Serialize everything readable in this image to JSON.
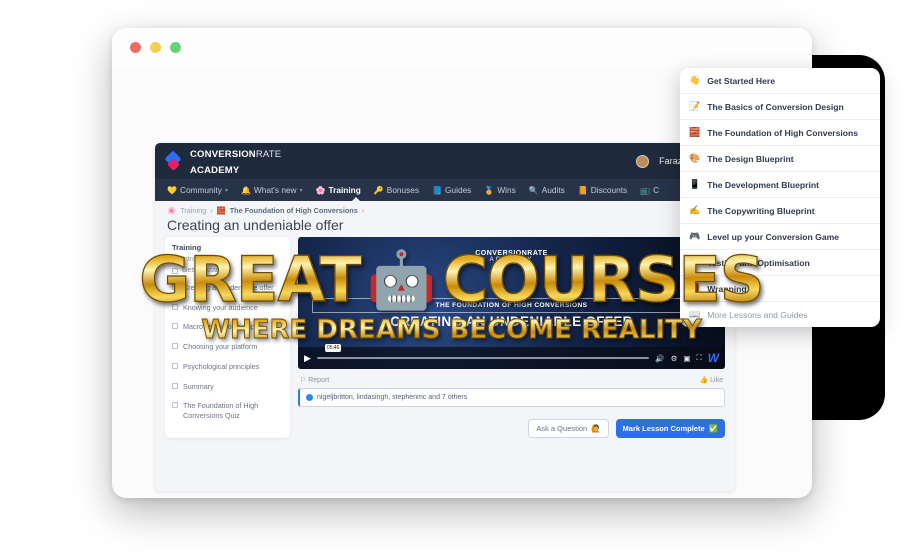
{
  "browser": {
    "traffic_lights": [
      "close",
      "minimize",
      "maximize"
    ]
  },
  "app": {
    "logo": {
      "line1_bold": "CONVERSION",
      "line1_thin": "RATE",
      "line2": "ACADEMY"
    },
    "user": {
      "name": "Faraz",
      "mail_icon": "mail-icon",
      "bell_icon": "bell-icon"
    },
    "nav": [
      {
        "label": "Community",
        "emoji": "💛",
        "caret": "▾",
        "active": false
      },
      {
        "label": "What's new",
        "emoji": "🔔",
        "caret": "▾",
        "active": false
      },
      {
        "label": "Training",
        "emoji": "🌸",
        "caret": "",
        "active": true
      },
      {
        "label": "Bonuses",
        "emoji": "🔑",
        "caret": "",
        "active": false
      },
      {
        "label": "Guides",
        "emoji": "📘",
        "caret": "",
        "active": false
      },
      {
        "label": "Wins",
        "emoji": "🏅",
        "caret": "",
        "active": false
      },
      {
        "label": "Audits",
        "emoji": "🔍",
        "caret": "",
        "active": false
      },
      {
        "label": "Discounts",
        "emoji": "📙",
        "caret": "",
        "active": false
      },
      {
        "label": "C",
        "emoji": "📺",
        "caret": "",
        "active": false
      }
    ],
    "breadcrumb": {
      "parent": "Training",
      "parent_emoji": "🌸",
      "current": "The Foundation of High Conversions",
      "current_emoji": "🧱",
      "separator": "›"
    },
    "page_title": "Creating an undeniable offer",
    "lesson_panel": {
      "heading": "Training",
      "sub1": "Introduction",
      "sub2": "Getting started",
      "items": [
        "Creating an undeniable offer",
        "Knowing your audience",
        "Macro vs micro principles",
        "Choosing your platform",
        "Psychological principles",
        "Summary",
        "The Foundation of High Conversions Quiz"
      ]
    },
    "video": {
      "brand_line1": "CONVERSIONRATE",
      "brand_line2": "ACADEMY",
      "band_title": "THE FOUNDATION OF HIGH CONVERSIONS",
      "title": "CREATING AN UNDENIABLE OFFER",
      "play_icon": "play-icon",
      "timestamp": "05:46",
      "volume_icon": "volume-icon",
      "settings_icon": "gear-icon",
      "pip_icon": "picture-in-picture-icon",
      "fullscreen_icon": "fullscreen-icon",
      "watermark": "W"
    },
    "actions": {
      "report_label": "Report",
      "report_icon": "flag-icon",
      "like_label": "Like",
      "like_icon": "thumbs-up-icon",
      "likes_text": "nigeljbritton, lindasingh, stephenmc and 7 others",
      "ask_question_label": "Ask a Question",
      "ask_question_emoji": "🙋",
      "mark_complete_label": "Mark Lesson Complete",
      "mark_complete_emoji": "✅"
    }
  },
  "dropdown": {
    "items": [
      {
        "emoji": "👋",
        "label": "Get Started Here",
        "muted": false
      },
      {
        "emoji": "📝",
        "label": "The Basics of Conversion Design",
        "muted": false
      },
      {
        "emoji": "🧱",
        "label": "The Foundation of High Conversions",
        "muted": false
      },
      {
        "emoji": "🎨",
        "label": "The Design Blueprint",
        "muted": false
      },
      {
        "emoji": "📱",
        "label": "The Development Blueprint",
        "muted": false
      },
      {
        "emoji": "✍️",
        "label": "The Copywriting Blueprint",
        "muted": false
      },
      {
        "emoji": "🎮",
        "label": "Level up your Conversion Game",
        "muted": false
      },
      {
        "emoji": "🧪",
        "label": "Testing and Optimisation",
        "muted": false
      },
      {
        "emoji": "🎁",
        "label": "Wrapping Up",
        "muted": false
      },
      {
        "emoji": "📖",
        "label": "More Lessons and Guides",
        "muted": true
      }
    ]
  },
  "overlay": {
    "word1": "GREAT",
    "emoji": "🤖",
    "word2": "COURSES",
    "subtitle": "WHERE DREAMS BECOME REALITY"
  },
  "colors": {
    "gold": "#e0a410",
    "nav_dark": "#1f2a3c",
    "primary_blue": "#2f6fe4"
  }
}
